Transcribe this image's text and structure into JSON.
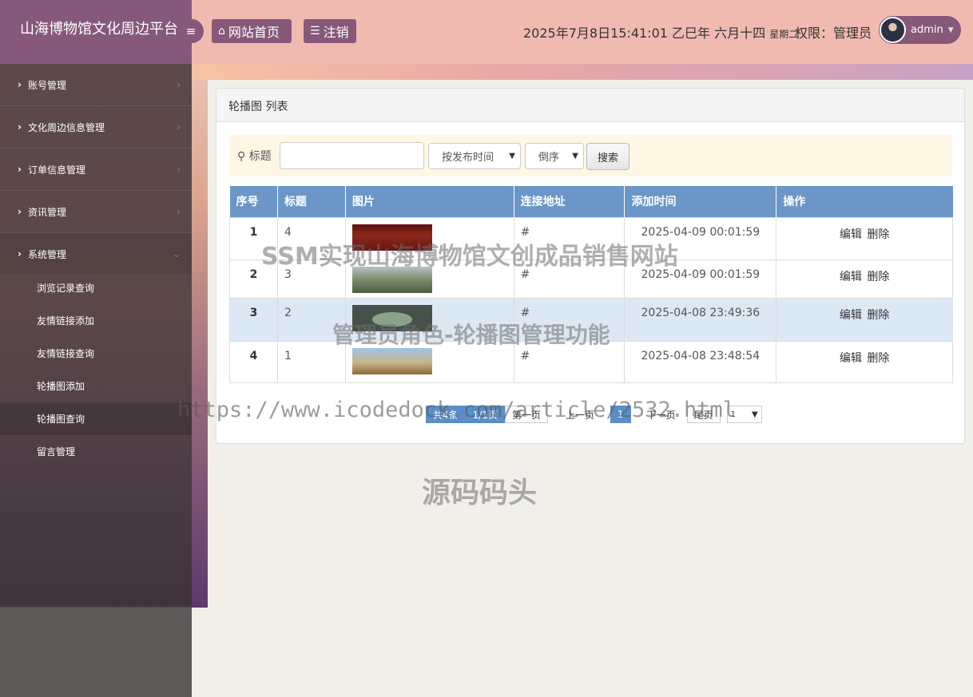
{
  "app": {
    "title": "山海博物馆文化周边平台",
    "toggle_icon": "≡"
  },
  "header": {
    "home_label": "网站首页",
    "logout_label": "注销",
    "datetime": "2025年7月8日15:41:01 乙巳年 六月十四",
    "weekday": "星期二",
    "role": "权限：管理员",
    "username": "admin"
  },
  "sidebar": {
    "items": [
      {
        "label": "账号管理"
      },
      {
        "label": "文化周边信息管理"
      },
      {
        "label": "订单信息管理"
      },
      {
        "label": "资讯管理"
      },
      {
        "label": "系统管理"
      }
    ],
    "sub_items": [
      {
        "label": "浏览记录查询"
      },
      {
        "label": "友情链接添加"
      },
      {
        "label": "友情链接查询"
      },
      {
        "label": "轮播图添加"
      },
      {
        "label": "轮播图查询"
      },
      {
        "label": "留言管理"
      }
    ]
  },
  "panel": {
    "title": "轮播图 列表",
    "search": {
      "label": "标题",
      "sort_field": "按发布时间",
      "sort_order": "倒序",
      "button": "搜索"
    },
    "table": {
      "headers": [
        "序号",
        "标题",
        "图片",
        "连接地址",
        "添加时间",
        "操作"
      ],
      "rows": [
        {
          "index": "1",
          "title": "4",
          "link": "#",
          "time": "2025-04-09 00:01:59",
          "edit": "编辑",
          "delete": "删除"
        },
        {
          "index": "2",
          "title": "3",
          "link": "#",
          "time": "2025-04-09 00:01:59",
          "edit": "编辑",
          "delete": "删除"
        },
        {
          "index": "3",
          "title": "2",
          "link": "#",
          "time": "2025-04-08 23:49:36",
          "edit": "编辑",
          "delete": "删除"
        },
        {
          "index": "4",
          "title": "1",
          "link": "#",
          "time": "2025-04-08 23:48:54",
          "edit": "编辑",
          "delete": "删除"
        }
      ]
    },
    "pager": {
      "total": "共4条",
      "pages": "1/1页",
      "first": "第一页",
      "prev": "上一页",
      "current": "1",
      "next": "下一页",
      "last": "尾页",
      "select": "1"
    }
  },
  "watermarks": {
    "line1": "SSM实现山海博物馆文创成品销售网站",
    "line2": "管理员角色-轮播图管理功能",
    "url": "https://www.icodedock.com/article/2532.html",
    "brand": "源码码头"
  }
}
